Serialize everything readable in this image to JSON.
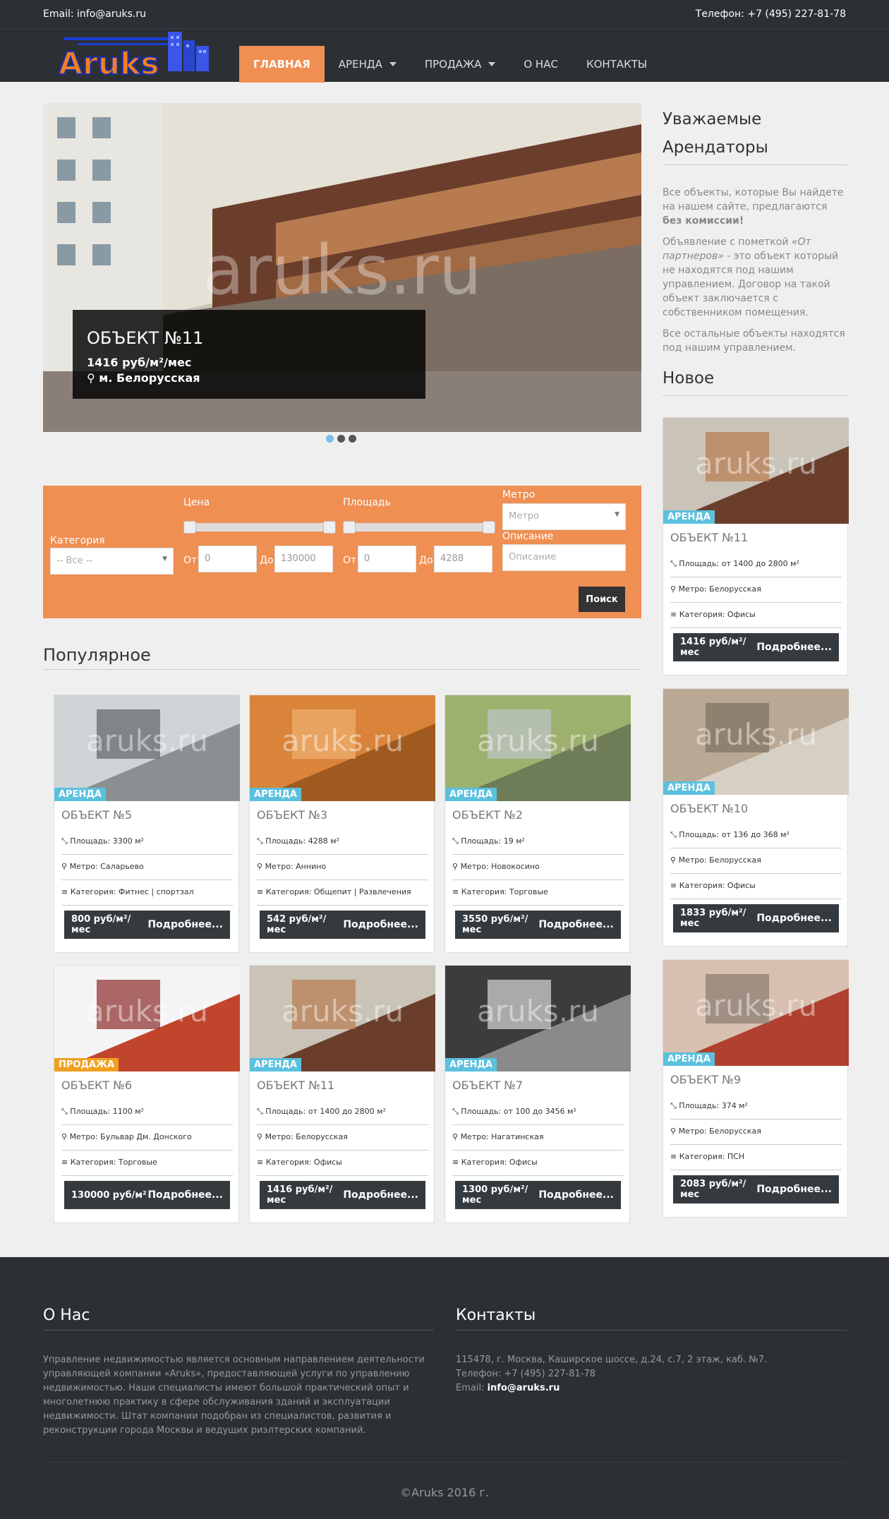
{
  "top": {
    "email": "Email: info@aruks.ru",
    "phone": "Телефон: +7 (495) 227-81-78"
  },
  "logo": {
    "text": "Aruks"
  },
  "nav": [
    "ГЛАВНАЯ",
    "АРЕНДА",
    "ПРОДАЖА",
    "О НАС",
    "КОНТАКТЫ"
  ],
  "slide": {
    "title": "ОБЪЕКТ №11",
    "price": "1416 руб/м²/мес",
    "metro": "м. Белорусская",
    "watermark": "aruks.ru"
  },
  "search": {
    "category_label": "Категория",
    "category_value": "-- Все --",
    "price_label": "Цена",
    "area_label": "Площадь",
    "metro_label": "Метро",
    "metro_placeholder": "Метро",
    "desc_label": "Описание",
    "desc_placeholder": "Описание",
    "from": "От",
    "to": "До",
    "price_from": "0",
    "price_to": "130000",
    "area_from": "0",
    "area_to": "4288",
    "button": "Поиск"
  },
  "popular_title": "Популярное",
  "more": "Подробнее...",
  "cards": [
    {
      "tag": "АРЕНДА",
      "title": "ОБЪЕКТ №5",
      "area": "Площадь: 3300 м²",
      "metro": "Метро: Саларьево",
      "cat": "Категория: Фитнес | спортзал",
      "price": "800 руб/м²/мес"
    },
    {
      "tag": "АРЕНДА",
      "title": "ОБЪЕКТ №3",
      "area": "Площадь: 4288 м²",
      "metro": "Метро: Аннино",
      "cat": "Категория: Общепит | Развлечения",
      "price": "542 руб/м²/мес"
    },
    {
      "tag": "АРЕНДА",
      "title": "ОБЪЕКТ №2",
      "area": "Площадь: 19 м²",
      "metro": "Метро: Новокосино",
      "cat": "Категория: Торговые",
      "price": "3550 руб/м²/мес"
    },
    {
      "tag": "ПРОДАЖА",
      "title": "ОБЪЕКТ №6",
      "area": "Площадь: 1100 м²",
      "metro": "Метро: Бульвар Дм. Донского",
      "cat": "Категория: Торговые",
      "price": "130000 руб/м²"
    },
    {
      "tag": "АРЕНДА",
      "title": "ОБЪЕКТ №11",
      "area": "Площадь: от 1400 до 2800 м²",
      "metro": "Метро: Белорусская",
      "cat": "Категория: Офисы",
      "price": "1416 руб/м²/мес"
    },
    {
      "tag": "АРЕНДА",
      "title": "ОБЪЕКТ №7",
      "area": "Площадь: от 100 до 3456 м²",
      "metro": "Метро: Нагатинская",
      "cat": "Категория: Офисы",
      "price": "1300 руб/м²/мес"
    }
  ],
  "side": {
    "title1": "Уважаемые",
    "title2": "Арендаторы",
    "p1a": "Все объекты, которые Вы найдете на нашем сайте, предлагаются ",
    "p1b": "без комиссии!",
    "p2a": "Объявление с пометкой ",
    "p2b": "«От партнеров»",
    "p2c": " - это объект который не находятся под нашим управлением. Договор на такой объект заключается с собственником помещения.",
    "p3": "Все остальные объекты находятся под нашим управлением.",
    "new_title": "Новое"
  },
  "new_cards": [
    {
      "tag": "АРЕНДА",
      "title": "ОБЪЕКТ №11",
      "area": "Площадь: от 1400 до 2800 м²",
      "metro": "Метро: Белорусская",
      "cat": "Категория: Офисы",
      "price": "1416 руб/м²/мес"
    },
    {
      "tag": "АРЕНДА",
      "title": "ОБЪЕКТ №10",
      "area": "Площадь: от 136 до 368 м²",
      "metro": "Метро: Белорусская",
      "cat": "Категория: Офисы",
      "price": "1833 руб/м²/мес"
    },
    {
      "tag": "АРЕНДА",
      "title": "ОБЪЕКТ №9",
      "area": "Площадь: 374 м²",
      "metro": "Метро: Белорусская",
      "cat": "Категория: ПСН",
      "price": "2083 руб/м²/мес"
    }
  ],
  "footer": {
    "about_title": "О Нас",
    "about_text": "Управление недвижимостью является основным направлением деятельности управляющей компании «Aruks», предоставляющей услуги по управлению недвижимостью. Наши специалисты имеют большой практический опыт и многолетнюю практику в сфере обслуживания зданий и эксплуатации недвижимости. Штат компании подобран из специалистов, развития и реконструкции города Москвы и ведущих риэлтерских компаний.",
    "contacts_title": "Контакты",
    "address": "115478, г. Москва, Каширское шоссе, д.24, с.7, 2 этаж, каб. №7.",
    "phone": "Телефон: +7 (495) 227-81-78",
    "email_label": "Email: ",
    "email": "info@aruks.ru",
    "copy": "©Aruks 2016 г."
  }
}
